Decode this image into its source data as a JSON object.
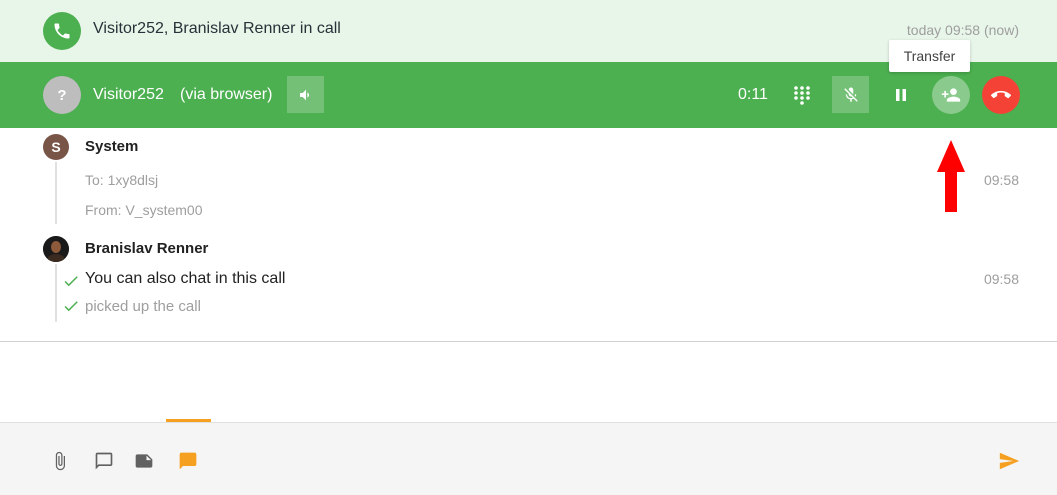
{
  "header": {
    "title": "Visitor252, Branislav Renner in call",
    "timestamp": "today 09:58 (now)",
    "icon": "phone-icon"
  },
  "call": {
    "avatar_letter": "?",
    "caller_name": "Visitor252",
    "caller_via": "(via browser)",
    "timer": "0:11",
    "tooltip": "Transfer",
    "controls": [
      "volume-icon",
      "dialpad-icon",
      "mic-off-icon",
      "pause-icon",
      "add-person-icon",
      "hangup-icon"
    ]
  },
  "messages": {
    "system": {
      "avatar_letter": "S",
      "sender": "System",
      "to": "To: 1xy8dlsj",
      "from": "From: V_system00",
      "time": "09:58"
    },
    "user": {
      "sender": "Branislav Renner",
      "text": "You can also chat in this call",
      "status": "picked up the call",
      "time": "09:58"
    }
  },
  "composer": {
    "tools": [
      "paperclip-icon",
      "chat-icon",
      "note-icon",
      "message-icon"
    ],
    "send": "send-icon"
  },
  "colors": {
    "green": "#4caf50",
    "light_green": "#e8f5e9",
    "red": "#f44336",
    "orange": "#f5a020",
    "check_green": "#4caf50"
  }
}
